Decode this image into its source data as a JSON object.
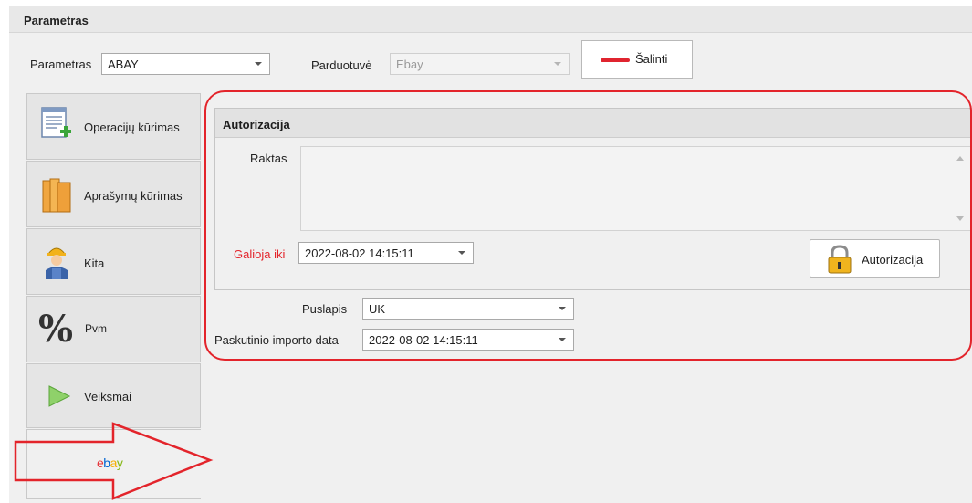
{
  "header": {
    "title": "Parametras"
  },
  "toolbar": {
    "param_label": "Parametras",
    "param_value": "ABAY",
    "store_label": "Parduotuvė",
    "store_value": "Ebay",
    "remove_label": "Šalinti"
  },
  "nav": {
    "items": [
      {
        "label": "Operacijų kūrimas",
        "icon": "document-add-icon"
      },
      {
        "label": "Aprašymų kūrimas",
        "icon": "books-icon"
      },
      {
        "label": "Kita",
        "icon": "worker-icon"
      },
      {
        "label": "Pvm",
        "icon": "percent-icon"
      },
      {
        "label": "Veiksmai",
        "icon": "play-icon"
      }
    ],
    "ebay": {
      "letters": [
        "e",
        "b",
        "a",
        "y"
      ],
      "colors": [
        "#e53238",
        "#0064d2",
        "#f5af02",
        "#86b817"
      ]
    }
  },
  "auth": {
    "title": "Autorizacija",
    "key_label": "Raktas",
    "key_value": "",
    "valid_label": "Galioja iki",
    "valid_value": "2022-08-02 14:15:11",
    "button_label": "Autorizacija"
  },
  "settings": {
    "page_label": "Puslapis",
    "page_value": "UK",
    "last_import_label": "Paskutinio importo data",
    "last_import_value": "2022-08-02 14:15:11"
  },
  "colors": {
    "highlight": "#e3242b",
    "required_label": "#e3242b",
    "remove_dash": "#e0242f"
  }
}
